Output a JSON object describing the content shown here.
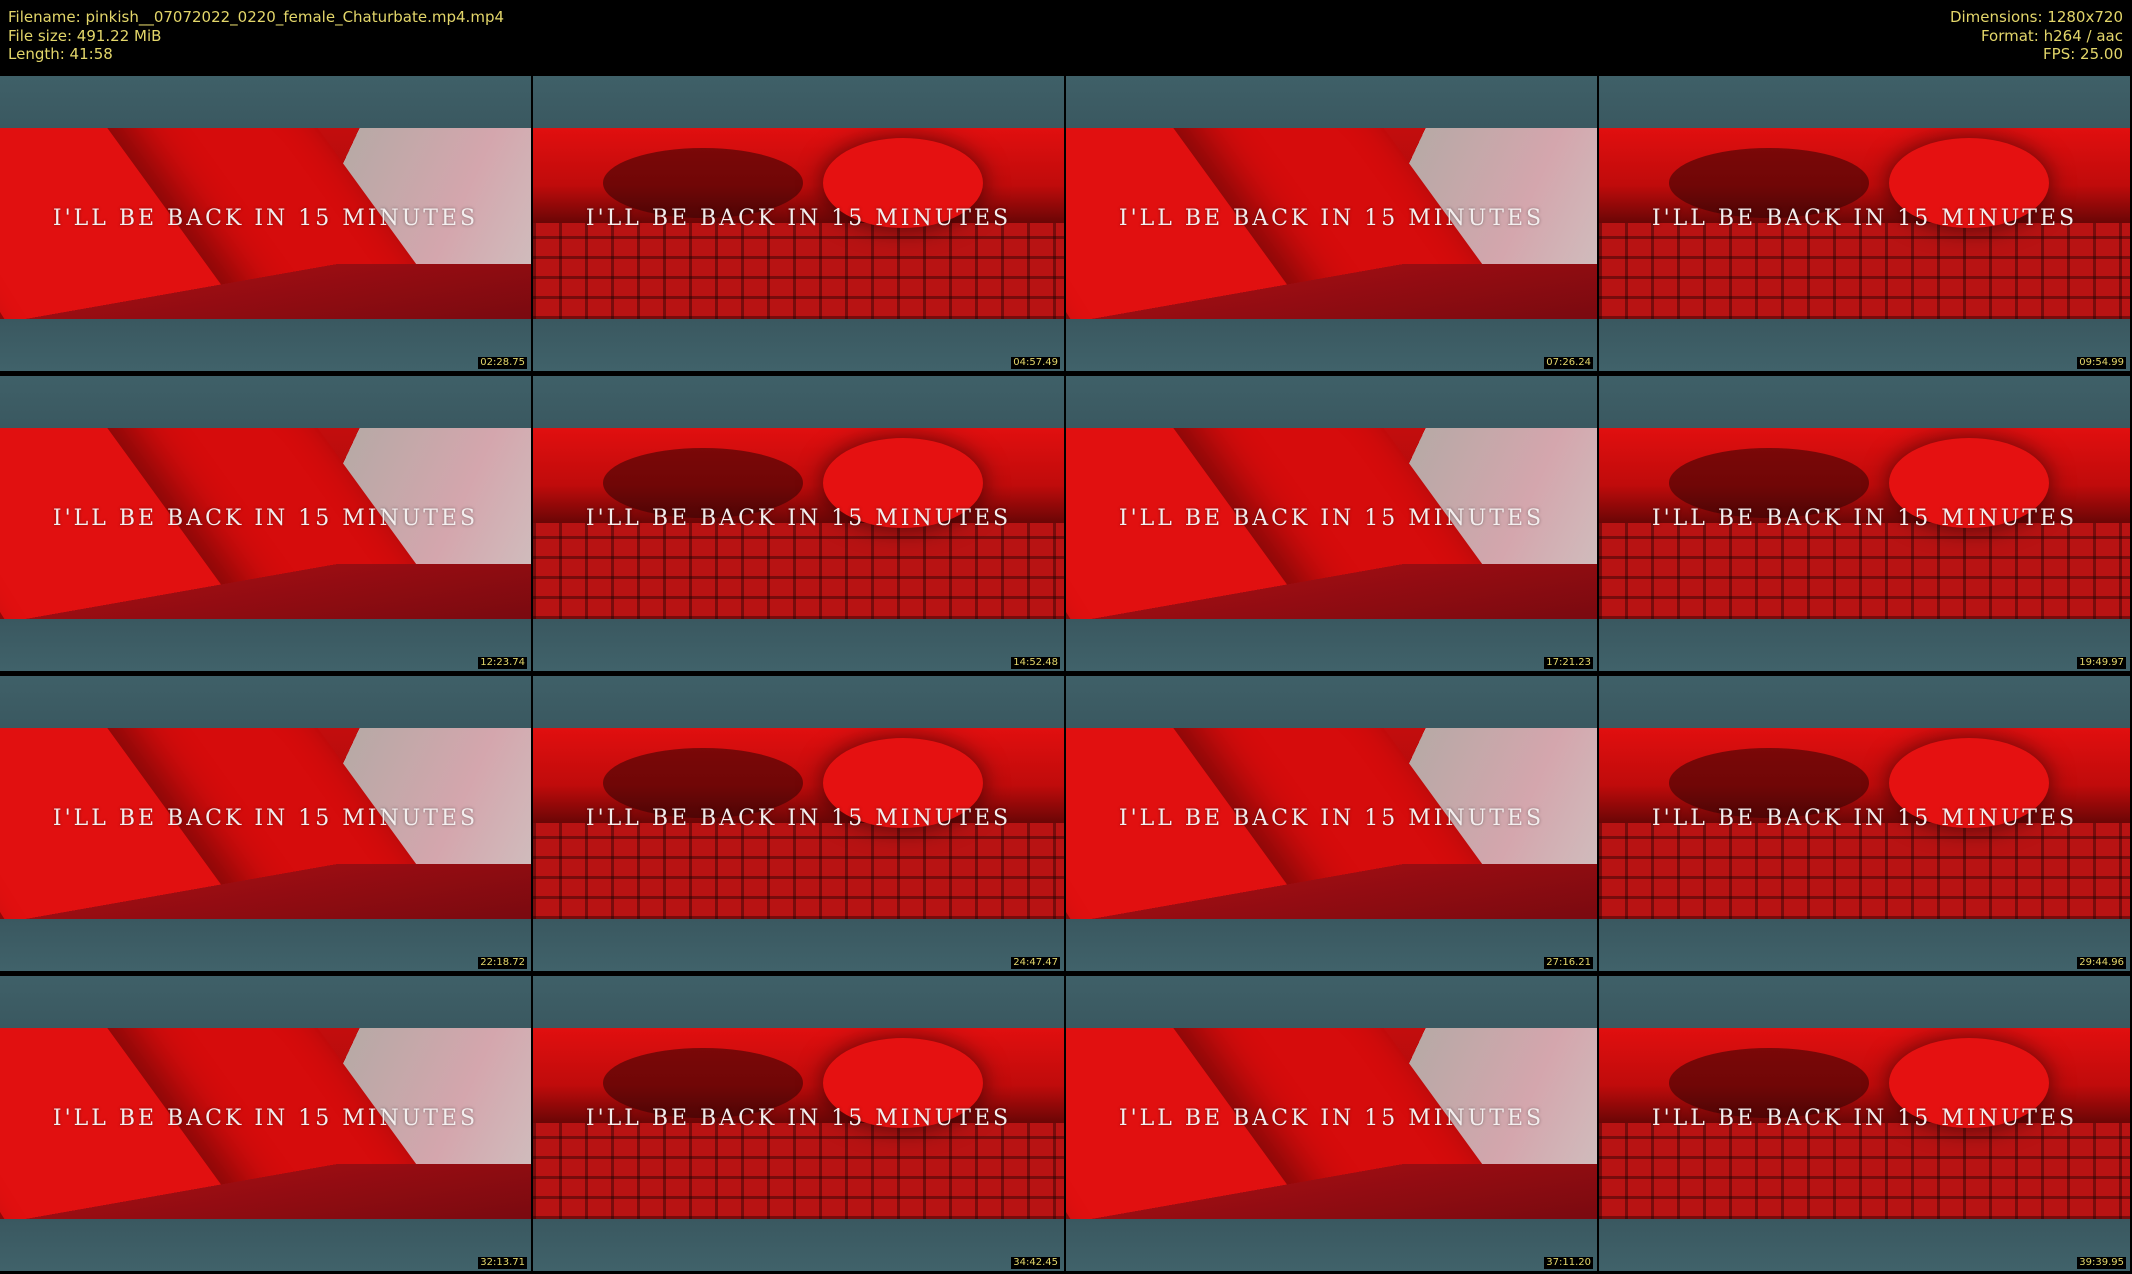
{
  "header": {
    "filename": "Filename: pinkish__07072022_0220_female_Chaturbate.mp4.mp4",
    "filesize": "File size: 491.22 MiB",
    "length": "Length: 41:58",
    "dimensions": "Dimensions: 1280x720",
    "format": "Format: h264 / aac",
    "fps": "FPS: 25.00"
  },
  "caption_text": "I'LL BE BACK IN 15 MINUTES",
  "thumbnails": [
    {
      "time": "02:28.75",
      "scene": "a"
    },
    {
      "time": "04:57.49",
      "scene": "b"
    },
    {
      "time": "07:26.24",
      "scene": "a"
    },
    {
      "time": "09:54.99",
      "scene": "b"
    },
    {
      "time": "12:23.74",
      "scene": "a"
    },
    {
      "time": "14:52.48",
      "scene": "b"
    },
    {
      "time": "17:21.23",
      "scene": "a"
    },
    {
      "time": "19:49.97",
      "scene": "b"
    },
    {
      "time": "22:18.72",
      "scene": "a"
    },
    {
      "time": "24:47.47",
      "scene": "b"
    },
    {
      "time": "27:16.21",
      "scene": "a"
    },
    {
      "time": "29:44.96",
      "scene": "b"
    },
    {
      "time": "32:13.71",
      "scene": "a"
    },
    {
      "time": "34:42.45",
      "scene": "b"
    },
    {
      "time": "37:11.20",
      "scene": "a"
    },
    {
      "time": "39:39.95",
      "scene": "b"
    }
  ],
  "colors": {
    "background": "#000000",
    "meta_text": "#e3d66a",
    "letterbox_band": "#3c5b63",
    "scene_red": "#d60c0c"
  }
}
